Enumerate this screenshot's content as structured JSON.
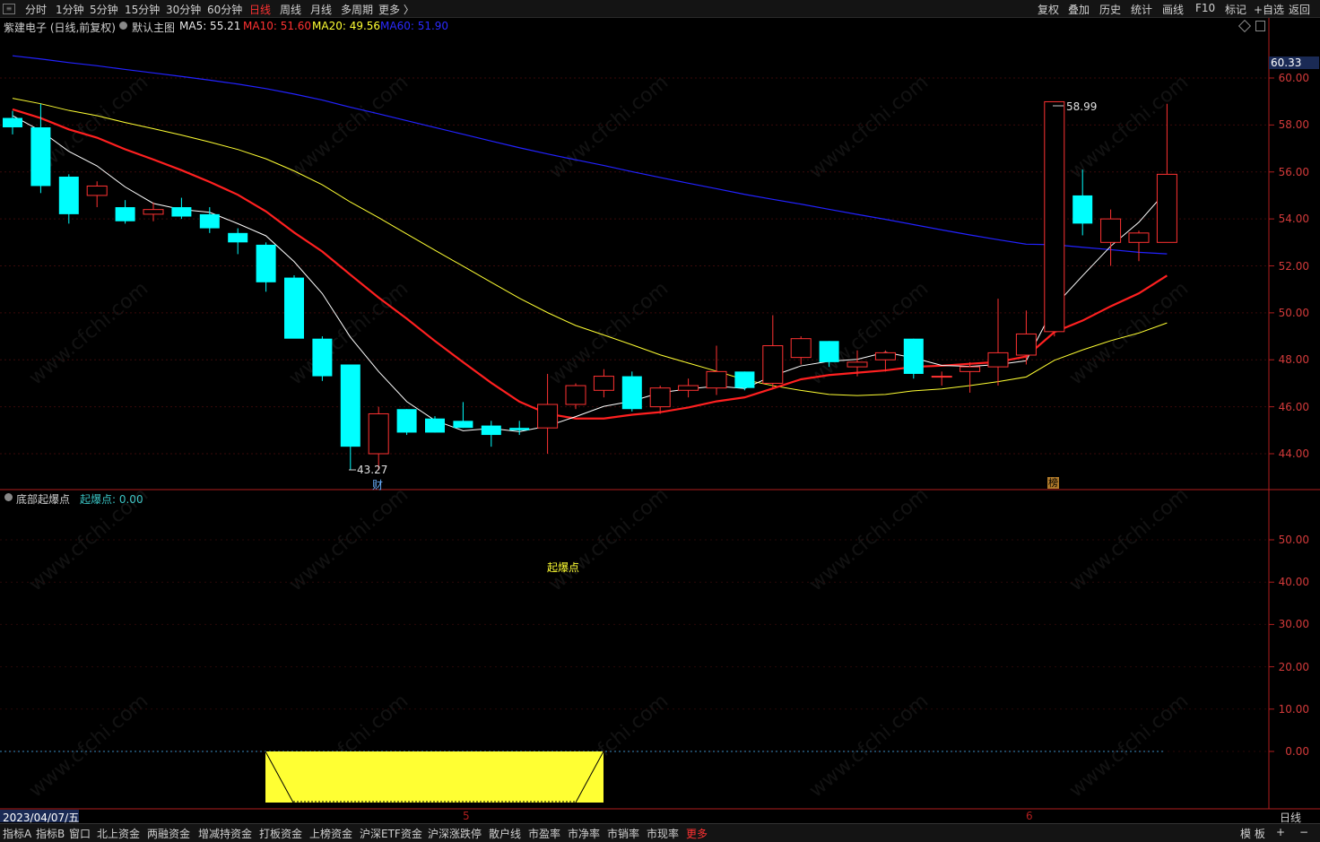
{
  "toolbar": {
    "tabs": [
      "分时",
      "1分钟",
      "5分钟",
      "15分钟",
      "30分钟",
      "60分钟",
      "日线",
      "周线",
      "月线",
      "多周期",
      "更多 〉"
    ],
    "active_tab": "日线",
    "right_tabs": [
      "复权",
      "叠加",
      "历史",
      "统计",
      "画线",
      "F10",
      "标记",
      "+自选",
      "返回"
    ]
  },
  "main_info": {
    "stock": "紫建电子 (日线,前复权)",
    "indicator": "默认主图",
    "ma5": "MA5: 55.21",
    "ma10": "MA10: 51.60",
    "ma20": "MA20: 49.56",
    "ma60": "MA60: 51.90"
  },
  "sub_info": {
    "name": "底部起爆点",
    "value": "起爆点: 0.00",
    "annotation": "起爆点"
  },
  "price_axis": {
    "current_price": "60.33",
    "ticks": [
      "60.00",
      "58.00",
      "56.00",
      "54.00",
      "52.00",
      "50.00",
      "48.00",
      "46.00",
      "44.00"
    ]
  },
  "sub_axis": {
    "ticks": [
      "50.00",
      "40.00",
      "30.00",
      "20.00",
      "10.00",
      "0.00"
    ]
  },
  "annotations": {
    "low": "43.27",
    "high": "58.99",
    "low_marker": "财",
    "high_marker": "榜"
  },
  "date_axis": {
    "date": "2023/04/07/五",
    "month5": "5",
    "month6": "6",
    "period": "日线"
  },
  "bottom_tabs": [
    "指标A",
    "指标B",
    "窗口",
    "北上资金",
    "两融资金",
    "增减持资金",
    "打板资金",
    "上榜资金",
    "沪深ETF资金",
    "沪深涨跌停",
    "散户线",
    "市盈率",
    "市净率",
    "市销率",
    "市现率",
    "更多"
  ],
  "bottom_right": [
    "模 板",
    "+",
    "−"
  ],
  "watermark": "www.cfchi.com",
  "colors": {
    "up": "#ff3232",
    "down": "#00ffff",
    "ma5": "#ffffff",
    "ma10": "#ff2020",
    "ma20": "#ffff33",
    "ma60": "#2222ff",
    "axis": "#c02020"
  },
  "chart_data": {
    "type": "candlestick",
    "series": [
      {
        "name": "MA5",
        "values": []
      },
      {
        "name": "MA10",
        "values": []
      },
      {
        "name": "MA20",
        "values": []
      },
      {
        "name": "MA60",
        "values": []
      }
    ],
    "ohlc": [
      [
        58.3,
        58.6,
        57.6,
        57.9
      ],
      [
        57.9,
        58.9,
        55.1,
        55.4
      ],
      [
        55.8,
        55.9,
        53.8,
        54.2
      ],
      [
        55.0,
        55.6,
        54.5,
        55.4
      ],
      [
        54.5,
        54.8,
        53.8,
        53.9
      ],
      [
        54.2,
        54.7,
        53.9,
        54.4
      ],
      [
        54.5,
        54.9,
        54.0,
        54.1
      ],
      [
        54.2,
        54.5,
        53.4,
        53.6
      ],
      [
        53.4,
        53.6,
        52.5,
        53.0
      ],
      [
        52.9,
        53.0,
        50.9,
        51.3
      ],
      [
        51.5,
        51.6,
        49.0,
        48.9
      ],
      [
        48.9,
        49.0,
        47.1,
        47.3
      ],
      [
        47.8,
        47.8,
        43.3,
        44.3
      ],
      [
        44.0,
        46.0,
        43.3,
        45.7
      ],
      [
        45.9,
        45.9,
        44.8,
        44.9
      ],
      [
        45.5,
        45.6,
        44.9,
        44.9
      ],
      [
        45.4,
        46.2,
        45.1,
        45.1
      ],
      [
        45.2,
        45.4,
        44.3,
        44.8
      ],
      [
        45.1,
        45.4,
        44.8,
        45.0
      ],
      [
        45.1,
        47.4,
        44.0,
        46.1
      ],
      [
        46.1,
        47.0,
        45.9,
        46.9
      ],
      [
        46.7,
        47.6,
        46.4,
        47.3
      ],
      [
        47.3,
        47.5,
        45.8,
        45.9
      ],
      [
        46.0,
        46.9,
        45.7,
        46.8
      ],
      [
        46.7,
        47.2,
        46.4,
        46.9
      ],
      [
        46.8,
        48.6,
        46.5,
        47.5
      ],
      [
        47.5,
        47.5,
        46.7,
        46.8
      ],
      [
        47.0,
        49.9,
        46.8,
        48.6
      ],
      [
        48.1,
        49.0,
        47.8,
        48.9
      ],
      [
        48.8,
        48.8,
        47.7,
        47.9
      ],
      [
        47.7,
        48.4,
        47.3,
        47.9
      ],
      [
        48.0,
        48.4,
        47.5,
        48.3
      ],
      [
        48.9,
        48.9,
        47.2,
        47.4
      ],
      [
        47.3,
        47.5,
        46.9,
        47.3
      ],
      [
        47.5,
        47.9,
        46.6,
        47.7
      ],
      [
        47.7,
        50.6,
        46.9,
        48.3
      ],
      [
        48.2,
        50.1,
        47.8,
        49.1
      ],
      [
        49.2,
        58.99,
        49.0,
        58.99
      ],
      [
        55.0,
        56.1,
        53.3,
        53.8
      ],
      [
        53.0,
        54.4,
        52.0,
        54.0
      ],
      [
        53.0,
        53.5,
        52.2,
        53.4
      ],
      [
        53.0,
        58.9,
        53.0,
        55.9
      ]
    ],
    "ylim": [
      42.5,
      62.0
    ]
  }
}
